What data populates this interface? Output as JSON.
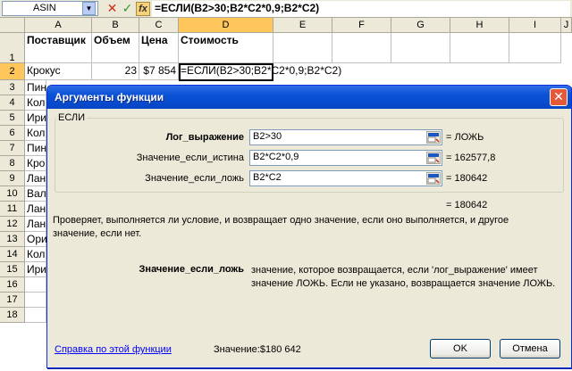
{
  "formula_bar": {
    "name_box": "ASIN",
    "formula": "=ЕСЛИ(B2>30;B2*C2*0,9;B2*C2)"
  },
  "columns": [
    "A",
    "B",
    "C",
    "D",
    "E",
    "F",
    "G",
    "H",
    "I",
    "J"
  ],
  "rows": [
    "1",
    "2",
    "3",
    "4",
    "5",
    "6",
    "7",
    "8",
    "9",
    "10",
    "11",
    "12",
    "13",
    "14",
    "15",
    "16",
    "17",
    "18"
  ],
  "headers": {
    "a": "Поставщик",
    "b": "Объем",
    "c": "Цена",
    "d": "Стоимость"
  },
  "row2": {
    "a": "Крокус",
    "b": "23",
    "c": "$7 854",
    "d": "=ЕСЛИ(B2>30;B2*C2*0,9;B2*C2)"
  },
  "col_a_partial": [
    "Пин",
    "Кол",
    "Ири",
    "Кол",
    "Пин",
    "Кро",
    "Лан",
    "Вал",
    "Лан",
    "Лан",
    "Ори",
    "Кол",
    "Ири"
  ],
  "dialog": {
    "title": "Аргументы функции",
    "group": "ЕСЛИ",
    "args": [
      {
        "label": "Лог_выражение",
        "value": "B2>30",
        "result": "= ЛОЖЬ"
      },
      {
        "label": "Значение_если_истина",
        "value": "B2*C2*0,9",
        "result": "= 162577,8"
      },
      {
        "label": "Значение_если_ложь",
        "value": "B2*C2",
        "result": "= 180642"
      }
    ],
    "total_result": "= 180642",
    "description": "Проверяет, выполняется ли условие, и возвращает одно значение, если оно выполняется, и другое значение, если нет.",
    "current_arg_name": "Значение_если_ложь",
    "current_arg_desc": "значение, которое возвращается, если 'лог_выражение' имеет значение ЛОЖЬ. Если не указано, возвращается значение ЛОЖЬ.",
    "help_link": "Справка по этой функции",
    "value_label": "Значение:$180 642",
    "ok": "OK",
    "cancel": "Отмена"
  }
}
